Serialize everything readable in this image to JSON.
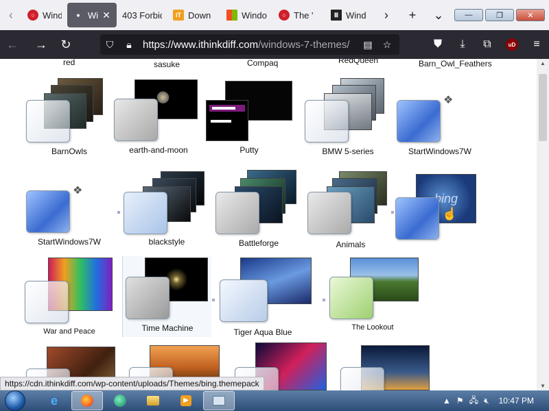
{
  "tabs": [
    {
      "label": "Wind",
      "icon": "opera-red-icon",
      "color": "#d0202a"
    },
    {
      "label": "Wi",
      "icon": "dot-icon",
      "active": true
    },
    {
      "label": "403 Forbid",
      "icon": "none"
    },
    {
      "label": "Down",
      "icon": "orange-logo-icon",
      "color": "#f0a020"
    },
    {
      "label": "Windo",
      "icon": "windows-logo-icon",
      "color": "#3a8fd8"
    },
    {
      "label": "The '",
      "icon": "opera-red-icon",
      "color": "#d0202a"
    },
    {
      "label": "Wind",
      "icon": "museum-icon",
      "color": "#222222"
    }
  ],
  "tab_controls": {
    "scroll_right": "›",
    "new_tab": "+",
    "list_all": "⌄"
  },
  "window_controls": {
    "minimize": "—",
    "restore": "❐",
    "close": "✕"
  },
  "url": {
    "domain": "https://www.ithinkdiff.com",
    "path": "/windows-7-themes/"
  },
  "top_captions": [
    "red",
    "sasuke",
    "Compaq",
    "RedQueen",
    "Barn_Owl_Feathers"
  ],
  "themes": [
    {
      "name": "BarnOwls",
      "style": "stack-dark"
    },
    {
      "name": "earth-and-moon",
      "style": "earth"
    },
    {
      "name": "Putty",
      "style": "putty"
    },
    {
      "name": "BMW 5-series",
      "style": "stack-car"
    },
    {
      "name": "StartWindows7W",
      "style": "blue-glass"
    },
    {
      "name": "StartWindows7W",
      "style": "blue-glass"
    },
    {
      "name": "blackstyle",
      "style": "stack-black"
    },
    {
      "name": "Battleforge",
      "style": "stack-game"
    },
    {
      "name": "Animals",
      "style": "stack-animals"
    },
    {
      "name": "",
      "style": "bing"
    },
    {
      "name": "War and Peace",
      "style": "rainbow"
    },
    {
      "name": "Time Machine",
      "style": "space"
    },
    {
      "name": "Tiger Aqua Blue",
      "style": "aqua"
    },
    {
      "name": "The Lookout",
      "style": "lookout"
    }
  ],
  "bottom_row": [
    "fortress",
    "sunset",
    "neon",
    "city"
  ],
  "status_url": "https://cdn.ithinkdiff.com/wp-content/uploads/Themes/bing.themepack",
  "taskbar": {
    "apps": [
      "ie-icon",
      "firefox-icon",
      "media-center-icon",
      "explorer-icon",
      "media-player-icon",
      "remote-icon"
    ],
    "clock": "10:47 PM"
  },
  "bing_logo": "bing",
  "colors": {
    "nav_bg": "#2b2a33",
    "tab_bg": "#f0f0f4",
    "urlbar_bg": "#1c1b22"
  }
}
